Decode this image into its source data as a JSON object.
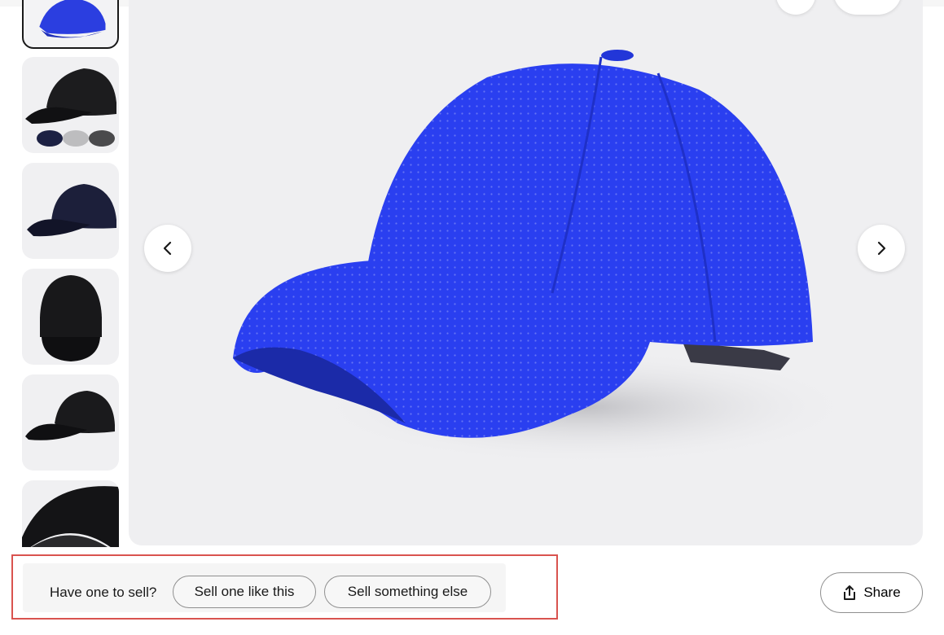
{
  "gallery": {
    "thumbnails": [
      {
        "name": "thumbnail-blue-cap",
        "color": "#2b3ee0",
        "selected": true
      },
      {
        "name": "thumbnail-black-cap-colors",
        "color": "#1c1c1e",
        "selected": false
      },
      {
        "name": "thumbnail-navy-cap",
        "color": "#1c1f3a",
        "selected": false
      },
      {
        "name": "thumbnail-black-cap-front",
        "color": "#18181a",
        "selected": false
      },
      {
        "name": "thumbnail-black-cap-side",
        "color": "#1a1a1c",
        "selected": false
      },
      {
        "name": "thumbnail-black-cap-brim",
        "color": "#141416",
        "selected": false
      }
    ],
    "prev_icon": "chevron-left-icon",
    "next_icon": "chevron-right-icon",
    "main_image": "blue-mesh-baseball-cap",
    "main_color": "#2a3ff0"
  },
  "sell": {
    "prompt": "Have one to sell?",
    "sell_like_this": "Sell one like this",
    "sell_something_else": "Sell something else"
  },
  "share": {
    "label": "Share",
    "icon": "share-icon"
  },
  "colors": {
    "highlight_border": "#d9534f"
  }
}
